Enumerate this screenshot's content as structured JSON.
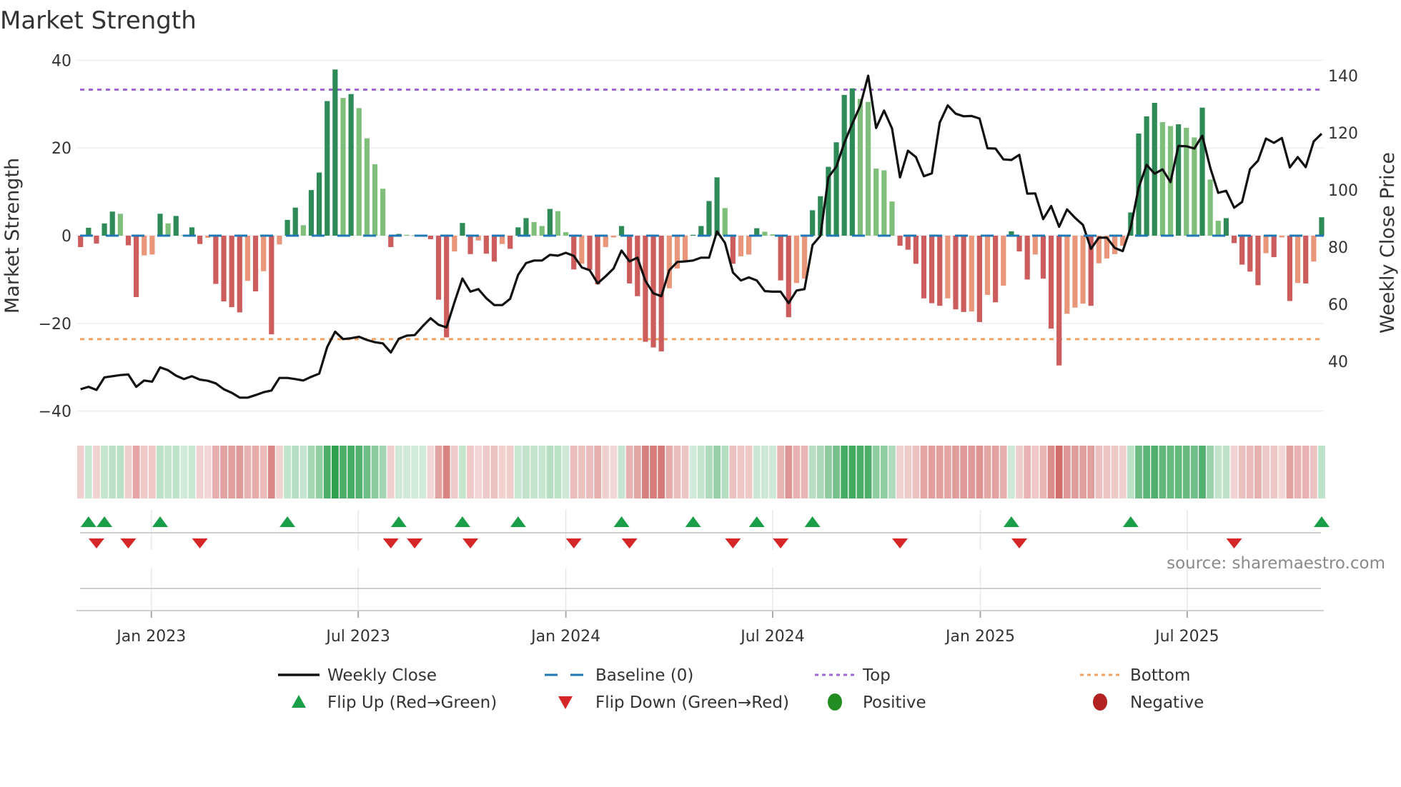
{
  "title": "Market Strength",
  "chart_data": {
    "type": "bar",
    "title": "Market Strength",
    "ylabel": "Market Strength",
    "y2label": "Weekly Close Price",
    "ylim": [
      -40,
      40
    ],
    "y2lim": [
      40,
      140
    ],
    "y_ticks": [
      "40",
      "20",
      "0",
      "−20",
      "−40"
    ],
    "y_tick_values": [
      40,
      20,
      0,
      -20,
      -40
    ],
    "y2_ticks": [
      "140",
      "120",
      "100",
      "80",
      "60",
      "40"
    ],
    "y2_tick_values": [
      140,
      120,
      100,
      80,
      60,
      40
    ],
    "x_ticks": [
      {
        "label": "Jan 2023",
        "week_index": 8.9
      },
      {
        "label": "Jul 2023",
        "week_index": 34.9
      },
      {
        "label": "Jan 2024",
        "week_index": 61.0
      },
      {
        "label": "Jul 2024",
        "week_index": 87.0
      },
      {
        "label": "Jan 2025",
        "week_index": 113.1
      },
      {
        "label": "Jul 2025",
        "week_index": 139.1
      }
    ],
    "top_level": 33.3,
    "bottom_level": -23.6,
    "baseline": 0,
    "strength": [
      -2.6,
      1.8,
      -1.8,
      2.8,
      5.5,
      5.0,
      -2.2,
      -14,
      -4.5,
      -4.3,
      5.0,
      2.8,
      4.5,
      0.1,
      1.9,
      -1.9,
      -0.5,
      -11,
      -15,
      -16.3,
      -17.5,
      -10.3,
      -12.7,
      -8.1,
      -22.5,
      -2.0,
      3.6,
      6.4,
      2.4,
      10.4,
      14.4,
      30.7,
      37.9,
      31.4,
      32.3,
      29.1,
      22.2,
      16.3,
      10.7,
      -2.6,
      0.4,
      0.2,
      0.1,
      0.1,
      -0.8,
      -14.6,
      -23.2,
      -3.6,
      2.9,
      -4.2,
      -1.1,
      -4.1,
      -5.9,
      -1.9,
      -3.0,
      1.9,
      4.0,
      3.1,
      2.2,
      6.1,
      5.6,
      0.8,
      -7.7,
      -6.4,
      -7.8,
      -11.1,
      -2.6,
      -0.4,
      2.2,
      -10.9,
      -13.8,
      -24.2,
      -25.5,
      -26.4,
      -12.0,
      -7.5,
      -5.6,
      0.2,
      2.2,
      7.9,
      13.3,
      6.3,
      -6.4,
      -4.7,
      -4.3,
      1.7,
      0.9,
      0.3,
      -10.2,
      -18.6,
      -10.8,
      -9.8,
      5.8,
      9.0,
      15.7,
      21.3,
      32.1,
      33.6,
      31.2,
      30.5,
      15.3,
      14.9,
      7.8,
      -2.3,
      -3.2,
      -6.4,
      -14.3,
      -15.4,
      -16.0,
      -14.3,
      -16.8,
      -17.4,
      -17.3,
      -19.7,
      -13.5,
      -15.2,
      -11.4,
      1.0,
      -3.6,
      -10.0,
      -4.3,
      -9.8,
      -21.2,
      -29.6,
      -17.8,
      -16.4,
      -15.5,
      -16.0,
      -6.3,
      -5.2,
      -4.2,
      -2.3,
      5.3,
      23.3,
      27.2,
      30.3,
      25.9,
      25.0,
      25.4,
      24.6,
      22.4,
      29.2,
      12.8,
      3.4,
      4.0,
      -1.7,
      -6.6,
      -8.2,
      -11.3,
      -4.0,
      -4.9,
      -0.4,
      -14.9,
      -10.8,
      -10.9,
      -5.9,
      4.2
    ],
    "weekly_close": [
      30.25,
      31.1,
      30,
      34.4,
      34.8,
      35.2,
      35.4,
      31.1,
      33.3,
      32.9,
      37.9,
      36.9,
      35.0,
      33.8,
      34.8,
      33.6,
      33.2,
      32.3,
      30.25,
      29,
      27.3,
      27.3,
      28.2,
      29.2,
      29.8,
      34.2,
      34.2,
      33.8,
      33.3,
      34.6,
      35.7,
      45,
      50.4,
      47.8,
      48.1,
      48.6,
      47.5,
      46.7,
      46.3,
      43.1,
      47.9,
      49,
      49.2,
      52.3,
      55.1,
      52.8,
      51.9,
      60.7,
      69,
      64.4,
      65.3,
      62.1,
      59.7,
      59.7,
      61.9,
      70.3,
      74.4,
      75.3,
      75.3,
      77.3,
      77,
      78,
      76.9,
      72.9,
      71.9,
      67.3,
      69.8,
      72.5,
      78.8,
      75,
      76.3,
      68.2,
      63.8,
      62.8,
      71.9,
      74.8,
      75,
      75.3,
      76.3,
      76.3,
      85.5,
      81.5,
      71.1,
      68.3,
      69.4,
      68.3,
      64.6,
      64.4,
      64.4,
      60.4,
      64.8,
      65.3,
      80.7,
      84,
      104.4,
      108.2,
      116.5,
      123.2,
      129.4,
      140,
      121.7,
      127.8,
      121.5,
      104.4,
      113.75,
      111.5,
      104.8,
      105.8,
      123.6,
      129.6,
      126.7,
      125.8,
      125.9,
      125,
      114.6,
      114.5,
      110.7,
      110.5,
      112.3,
      98.7,
      98.8,
      89.8,
      94.4,
      87.1,
      93.2,
      90.25,
      87.75,
      79.4,
      83.3,
      83.3,
      79.7,
      78.6,
      86.9,
      100.8,
      108.8,
      105.7,
      107.2,
      102.75,
      115.4,
      115.3,
      114.5,
      119,
      107.75,
      99,
      99.7,
      93.8,
      95.8,
      107.3,
      110.25,
      118,
      116.5,
      118.2,
      107.9,
      111.5,
      108,
      117,
      119.7
    ],
    "flip_up_weeks": [
      1,
      3,
      10,
      26,
      40,
      48,
      55,
      68,
      77,
      85,
      92,
      117,
      132,
      156
    ],
    "flip_down_weeks": [
      2,
      6,
      15,
      39,
      42,
      49,
      62,
      69,
      82,
      88,
      103,
      118,
      145
    ],
    "colors": {
      "positive_rising": "#2e8b57",
      "positive_falling": "#7fbf7b",
      "negative_falling": "#cd5c5c",
      "negative_rising": "#e9967a",
      "close_line": "#111111",
      "baseline": "#1f77b4",
      "top": "#a066d3",
      "bottom": "#f0a060",
      "flip_up": "#1a9e48",
      "flip_down": "#d62728",
      "positive": "#228b22",
      "negative": "#b22222"
    },
    "legend": {
      "placement": "bottom-center",
      "items": [
        {
          "label": "Weekly Close",
          "symbol": "line"
        },
        {
          "label": "Baseline (0)",
          "symbol": "dash"
        },
        {
          "label": "Top",
          "symbol": "dot"
        },
        {
          "label": "Bottom",
          "symbol": "dot"
        },
        {
          "label": "Flip Up (Red→Green)",
          "symbol": "triangle-up"
        },
        {
          "label": "Flip Down (Green→Red)",
          "symbol": "triangle-down"
        },
        {
          "label": "Positive",
          "symbol": "circle"
        },
        {
          "label": "Negative",
          "symbol": "circle"
        }
      ]
    }
  },
  "source": "source: sharemaestro.com"
}
